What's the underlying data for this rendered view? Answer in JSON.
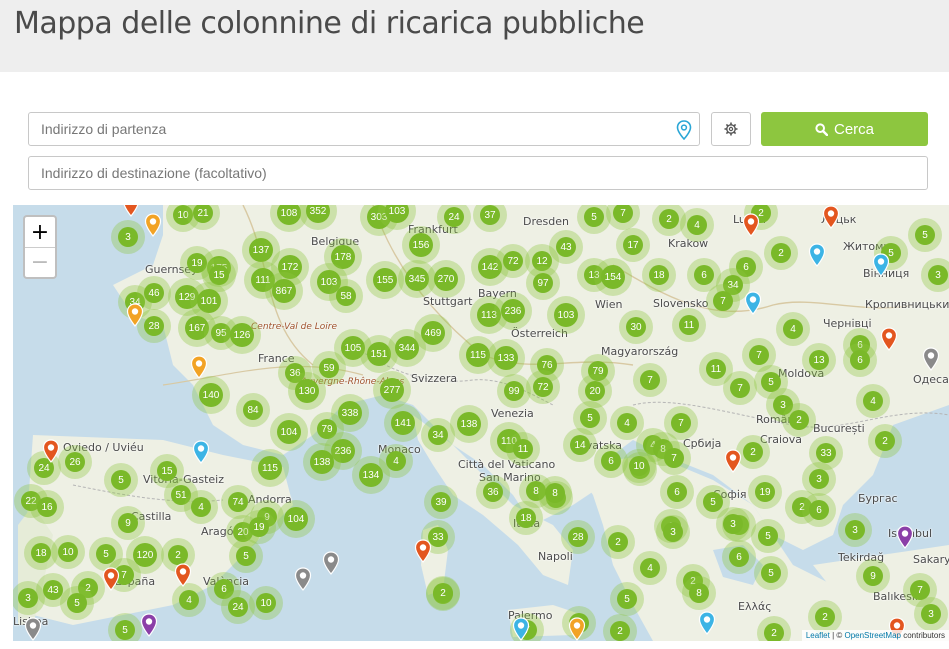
{
  "header": {
    "title": "Mappa delle colonnine di ricarica pubbliche"
  },
  "search": {
    "start_placeholder": "Indirizzo di partenza",
    "dest_placeholder": "Indirizzo di destinazione (facoltativo)",
    "search_label": "Cerca"
  },
  "map": {
    "zoom_in": "+",
    "zoom_out": "−",
    "attribution": {
      "leaflet": "Leaflet",
      "separator": " | © ",
      "osm": "OpenStreetMap",
      "suffix": " contributors"
    },
    "place_labels": [
      "Belgique",
      "Frankfurt",
      "Dresden",
      "Krakow",
      "Lublin",
      "Луцьк",
      "Житомир",
      "Guernsey",
      "Stuttgart",
      "Bayern",
      "Wien",
      "Slovensko",
      "Чернівці",
      "Вінниця",
      "Кропивницький",
      "Österreich",
      "Magyarország",
      "Centre-Val de Loire",
      "France",
      "Svizzera",
      "Venezia",
      "Moldova",
      "Одеса",
      "Monaco",
      "Hrvatska",
      "România",
      "Craiova",
      "București",
      "Oviedo / Uviéu",
      "Vitoria-Gasteiz",
      "Andorra",
      "Castilla",
      "Aragón",
      "Città del Vaticano",
      "San Marino",
      "Italia",
      "Србија",
      "Софія",
      "Бургас",
      "Napoli",
      "Tekirdağ",
      "España",
      "València",
      "Balıkesir",
      "Ελλάς",
      "Lisboa",
      "Palermo",
      "Istanbul",
      "Sakarya",
      "Auvergne-Rhône-Alpes"
    ],
    "clusters": [
      "10",
      "21",
      "108",
      "352",
      "303",
      "103",
      "24",
      "37",
      "5",
      "7",
      "2",
      "4",
      "2",
      "3",
      "5",
      "5",
      "3",
      "137",
      "175",
      "178",
      "156",
      "43",
      "17",
      "6",
      "2",
      "19",
      "15",
      "111",
      "172",
      "103",
      "155",
      "345",
      "270",
      "142",
      "72",
      "12",
      "97",
      "13",
      "154",
      "18",
      "6",
      "34",
      "7",
      "34",
      "46",
      "129",
      "101",
      "867",
      "58",
      "113",
      "236",
      "103",
      "30",
      "11",
      "4",
      "6",
      "28",
      "167",
      "95",
      "126",
      "105",
      "151",
      "344",
      "469",
      "115",
      "133",
      "76",
      "79",
      "7",
      "13",
      "6",
      "36",
      "59",
      "277",
      "99",
      "72",
      "20",
      "7",
      "11",
      "7",
      "5",
      "3",
      "4",
      "140",
      "84",
      "130",
      "338",
      "141",
      "34",
      "138",
      "110",
      "5",
      "4",
      "7",
      "2",
      "104",
      "79",
      "236",
      "4",
      "11",
      "14",
      "6",
      "4",
      "2",
      "33",
      "2",
      "24",
      "26",
      "15",
      "115",
      "138",
      "134",
      "6",
      "8",
      "10",
      "7",
      "19",
      "3",
      "5",
      "51",
      "74",
      "104",
      "36",
      "13",
      "9",
      "6",
      "5",
      "2",
      "6",
      "3",
      "2",
      "22",
      "16",
      "4",
      "9",
      "20",
      "19",
      "39",
      "18",
      "8",
      "8",
      "3",
      "5",
      "6",
      "6",
      "18",
      "10",
      "5",
      "120",
      "2",
      "5",
      "33",
      "28",
      "2",
      "4",
      "3",
      "5",
      "9",
      "3",
      "43",
      "2",
      "7",
      "4",
      "6",
      "24",
      "10",
      "2",
      "5",
      "2",
      "8",
      "7",
      "5",
      "5",
      "7",
      "2",
      "2",
      "9",
      "2",
      "2",
      "3",
      "2"
    ]
  },
  "colors": {
    "accent": "#8dc63f",
    "cluster": "#7ab929",
    "marker_orange": "#e3561f",
    "marker_yellow": "#f2a325",
    "marker_blue": "#3cb4e5",
    "marker_purple": "#8b3fa8",
    "marker_gray": "#8a8a8a"
  },
  "icons": [
    "map-pin-icon",
    "gear-icon",
    "search-icon"
  ]
}
